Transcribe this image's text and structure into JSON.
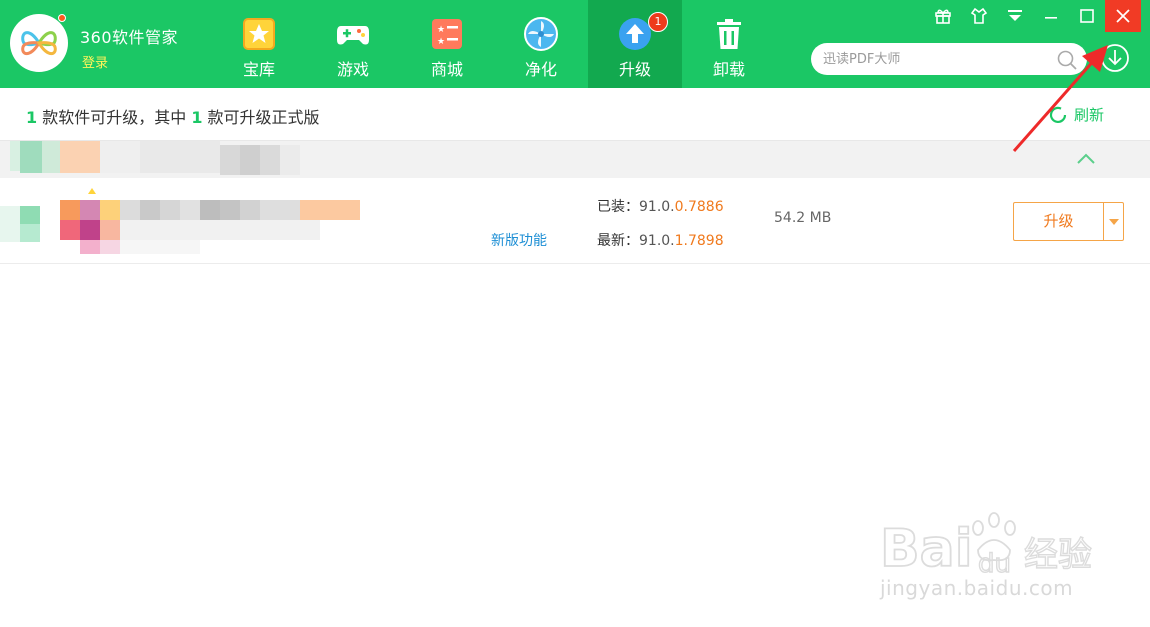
{
  "app": {
    "name": "360软件管家",
    "login_label": "登录"
  },
  "nav": [
    {
      "label": "宝库",
      "icon": "star-box-icon"
    },
    {
      "label": "游戏",
      "icon": "gamepad-icon"
    },
    {
      "label": "商城",
      "icon": "store-list-icon"
    },
    {
      "label": "净化",
      "icon": "fan-icon"
    },
    {
      "label": "升级",
      "icon": "upgrade-arrow-icon",
      "badge": "1",
      "active": true
    },
    {
      "label": "卸载",
      "icon": "trash-icon"
    }
  ],
  "search": {
    "placeholder": "迅读PDF大师"
  },
  "summary": {
    "count_a": "1",
    "text_a": " 款软件可升级，其中 ",
    "count_b": "1",
    "text_b": " 款可升级正式版"
  },
  "refresh_label": "刷新",
  "app_row": {
    "new_feature_label": "新版功能",
    "installed_label": "已装：",
    "installed_base": "91.0.",
    "installed_diff": "0.7886",
    "latest_label": "最新：",
    "latest_base": "91.0.",
    "latest_diff": "1.7898",
    "size": "54.2 MB",
    "upgrade_label": "升级"
  },
  "watermark": {
    "brand": "Bai 经验",
    "url": "jingyan.baidu.com"
  },
  "colors": {
    "brand_green": "#1bc765",
    "active_tab": "#12a94f",
    "close_red": "#f13b25",
    "accent_orange": "#f07a1e",
    "link_blue": "#1e8fd5"
  }
}
